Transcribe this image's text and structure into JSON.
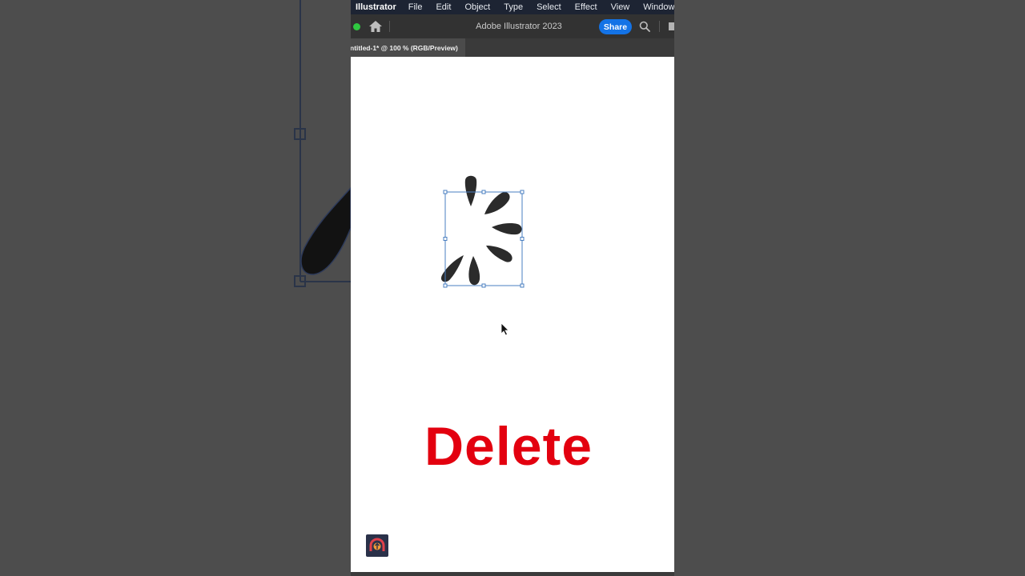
{
  "menubar": {
    "app_name": "Illustrator",
    "items": [
      "File",
      "Edit",
      "Object",
      "Type",
      "Select",
      "Effect",
      "View",
      "Window"
    ]
  },
  "toolbar": {
    "title": "Adobe Illustrator 2023",
    "share_label": "Share",
    "icons": [
      "home-icon",
      "search-icon",
      "panel-toggle-icon"
    ]
  },
  "document": {
    "tab_label": "ntitled-1* @ 100 % (RGB/Preview)"
  },
  "canvas": {
    "overlay_text": "Delete",
    "overlay_color": "#e3000f",
    "shape_fill": "#2b2b2b",
    "selection_color": "#4a7fc1"
  },
  "colors": {
    "menubar_bg": "#1d2433",
    "share_button": "#1473e6",
    "status_dot": "#2fc840"
  }
}
